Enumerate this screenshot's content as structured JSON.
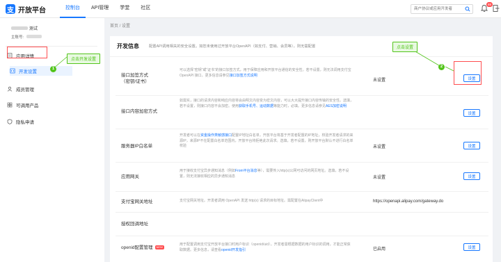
{
  "header": {
    "logo_mark": "支",
    "logo_text": "开放平台",
    "nav": [
      "控制台",
      "API管理",
      "学堂",
      "社区"
    ],
    "search_placeholder": "商户协议或应用开发者",
    "badge": "88"
  },
  "sidebar": {
    "user_name": "测试",
    "user_id_label": "主账号:",
    "items": [
      {
        "label": "应用详情"
      },
      {
        "label": "开发设置"
      },
      {
        "label": "成员管理"
      },
      {
        "label": "可调用产品"
      },
      {
        "label": "隐私申请"
      }
    ]
  },
  "breadcrumb": "首页 / 设置",
  "card": {
    "title": "开发信息",
    "desc": "配置API调用相关的安全设置。如您未使用过开放平台OpenAPI（如支付、营销、会员等），则无需配置"
  },
  "rows": [
    {
      "label_line1": "接口加签方式",
      "label_line2": "（密钥/证书）",
      "desc": "可以选择“密钥”或“证书”的接口加签方式，用于保障应用和开放平台通信的安全性。若不设置，则无法调用支付宝 OpenAPI 接口。更多信息请参见",
      "link": "接口加签方式说明",
      "status": "未设置",
      "button": "设置"
    },
    {
      "label_line1": "接口内容加密方式",
      "label_line2": "",
      "desc": "如需实，接口的请求内容和响应内容将会由明文内容变为密文内容，可以大大提升接口内容传输的安全性。选填，若不设置，则接口内容不会加密。使用",
      "link": "获取手机号、运动数据",
      "desc_tail": "等能力时，必填。更多信息请参见",
      "link2": "AES加密说明",
      "status": "",
      "button": "设置"
    },
    {
      "label_line1": "服务器IP白名单",
      "label_line2": "",
      "desc": "开发者可以在",
      "link": "资金操作类敏感接口",
      "desc_tail": "配置IP地址白名单，开放平台将基于开发者配置的IP地址，校验开发者请求的来源IP，来源IP不在配置白名单范围内，开放平台将拒绝此次请求。选填，若不设置，则开放平台默认不进行白名单校验",
      "status": "未设置",
      "button": "设置"
    },
    {
      "label_line1": "应用网关",
      "label_line2": "",
      "desc": "用于接收支付宝异步通知消息（例如",
      "link": "From平台消息",
      "desc_tail": "等），需要传入http(s)公网可访问的网页地址。选填，若不设置，则无法接收相应的异步通知消息",
      "status": "未设置",
      "button": "设置"
    },
    {
      "label_line1": "支付宝网关地址",
      "label_line2": "",
      "desc": "支付宝网关地址。开发者调用 OpenAPI 发送 http(s) 请求的目标地址。需配置在AlipayClient中",
      "status": "https://openapi.alipay.com/gateway.do",
      "button": ""
    },
    {
      "label_line1": "授权回调地址",
      "label_line2": "",
      "desc": "",
      "status": "",
      "button": ""
    },
    {
      "label_line1": "openid配置管理",
      "tag": "NEW",
      "desc": "用于配置调用支付宝开放平台接口时用户标识（openid/uid）。开发者需根据数据的用户标识的调用，才能正常获取数据。更多信息，请查看",
      "link": "openid开发指引",
      "status": "已启用",
      "button": "设置"
    }
  ],
  "annotations": {
    "step1_label": "点击开发设置",
    "step1_num": "1",
    "step2_label": "点击设置",
    "step2_num": "2"
  }
}
